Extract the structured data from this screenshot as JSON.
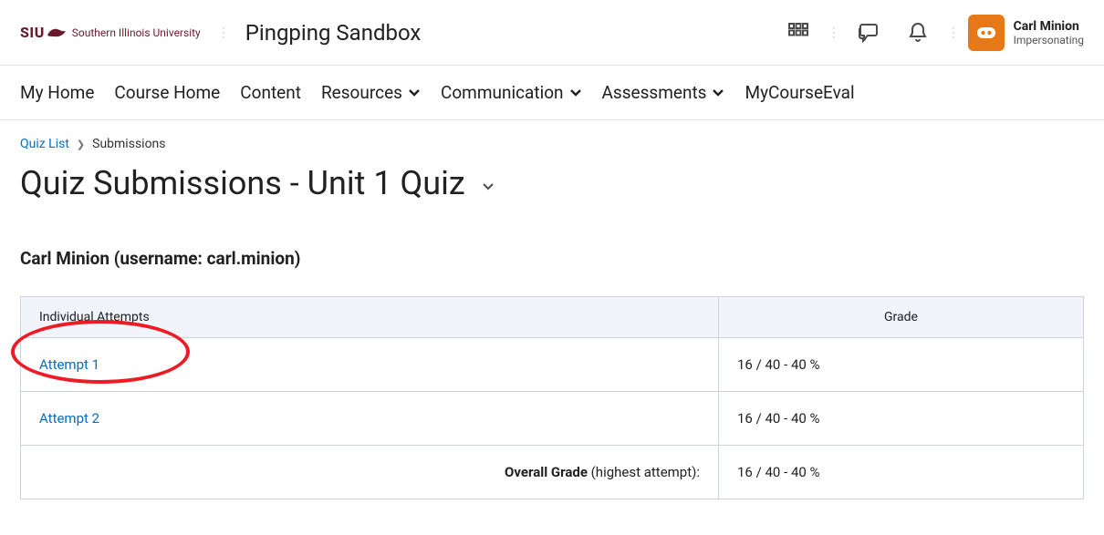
{
  "header": {
    "org_short": "SIU",
    "org_long": "Southern Illinois University",
    "course_title": "Pingping Sandbox",
    "user": {
      "name": "Carl Minion",
      "status": "Impersonating"
    }
  },
  "nav": {
    "items": [
      {
        "label": "My Home",
        "dropdown": false
      },
      {
        "label": "Course Home",
        "dropdown": false
      },
      {
        "label": "Content",
        "dropdown": false
      },
      {
        "label": "Resources",
        "dropdown": true
      },
      {
        "label": "Communication",
        "dropdown": true
      },
      {
        "label": "Assessments",
        "dropdown": true
      },
      {
        "label": "MyCourseEval",
        "dropdown": false
      }
    ]
  },
  "breadcrumb": {
    "parent": "Quiz List",
    "current": "Submissions"
  },
  "page": {
    "title": "Quiz Submissions - Unit 1 Quiz",
    "student_line": "Carl Minion (username: carl.minion)"
  },
  "table": {
    "headers": {
      "attempts": "Individual Attempts",
      "grade": "Grade"
    },
    "rows": [
      {
        "attempt": "Attempt 1",
        "grade": "16 / 40 - 40 %"
      },
      {
        "attempt": "Attempt 2",
        "grade": "16 / 40 - 40 %"
      }
    ],
    "overall": {
      "label": "Overall Grade",
      "sub": " (highest attempt):",
      "grade": "16 / 40 - 40 %"
    }
  }
}
